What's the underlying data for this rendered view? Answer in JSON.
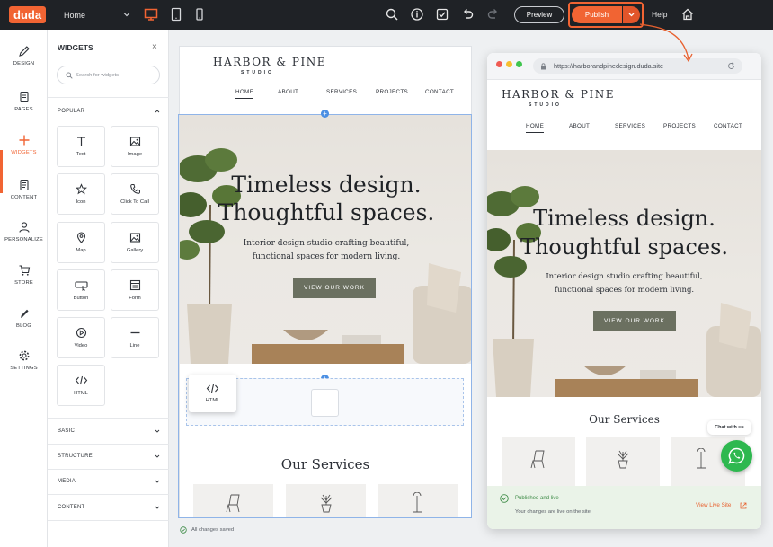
{
  "app": {
    "logo": "duda"
  },
  "topbar": {
    "page_selector": "Home",
    "preview_label": "Preview",
    "publish_label": "Publish",
    "help_label": "Help",
    "icons": [
      "search-icon",
      "info-icon",
      "checkbox-icon",
      "undo-icon",
      "redo-icon",
      "home-icon",
      "desktop-icon",
      "tablet-icon",
      "mobile-icon"
    ],
    "accent": "#f16433"
  },
  "rail": {
    "items": [
      {
        "label": "DESIGN",
        "icon": "pencil-icon"
      },
      {
        "label": "PAGES",
        "icon": "pages-icon"
      },
      {
        "label": "WIDGETS",
        "icon": "plus-icon"
      },
      {
        "label": "CONTENT",
        "icon": "content-icon"
      },
      {
        "label": "PERSONALIZE",
        "icon": "person-icon"
      },
      {
        "label": "STORE",
        "icon": "cart-icon"
      },
      {
        "label": "BLOG",
        "icon": "blog-icon"
      },
      {
        "label": "SETTINGS",
        "icon": "gear-icon"
      }
    ],
    "active": "WIDGETS"
  },
  "panel": {
    "title": "WIDGETS",
    "search_placeholder": "Search for widgets",
    "popular_label": "POPULAR",
    "widgets": [
      {
        "label": "Text",
        "icon": "text-icon"
      },
      {
        "label": "Image",
        "icon": "image-icon"
      },
      {
        "label": "Icon",
        "icon": "star-icon"
      },
      {
        "label": "Click To Call",
        "icon": "phone-icon"
      },
      {
        "label": "Map",
        "icon": "map-pin-icon"
      },
      {
        "label": "Gallery",
        "icon": "gallery-icon"
      },
      {
        "label": "Button",
        "icon": "button-icon"
      },
      {
        "label": "Form",
        "icon": "form-icon"
      },
      {
        "label": "Video",
        "icon": "play-icon"
      },
      {
        "label": "Line",
        "icon": "line-icon"
      },
      {
        "label": "HTML",
        "icon": "code-icon"
      }
    ],
    "sections": [
      "BASIC",
      "STRUCTURE",
      "MEDIA",
      "CONTENT"
    ],
    "autosave": "All changes saved"
  },
  "site": {
    "brand_name": "HARBOR & PINE",
    "brand_sub": "STUDIO",
    "nav": [
      "HOME",
      "ABOUT",
      "SERVICES",
      "PROJECTS",
      "CONTACT"
    ],
    "hero_line1": "Timeless design.",
    "hero_line2": "Thoughtful spaces.",
    "hero_sub1": "Interior design studio crafting beautiful,",
    "hero_sub2": "functional spaces for modern living.",
    "hero_button": "VIEW OUR WORK",
    "services_title": "Our Services",
    "service_icons": [
      "chair-icon",
      "plant-icon",
      "lamp-icon"
    ]
  },
  "editor": {
    "dragging_widget": "HTML"
  },
  "live": {
    "url": "https://harborandpinedesign.duda.site",
    "toast_title": "Published and live",
    "toast_sub": "Your changes are live on the site",
    "toast_link": "View Live Site",
    "chat_label": "Chat with us",
    "status_color": "#3d8b46"
  }
}
